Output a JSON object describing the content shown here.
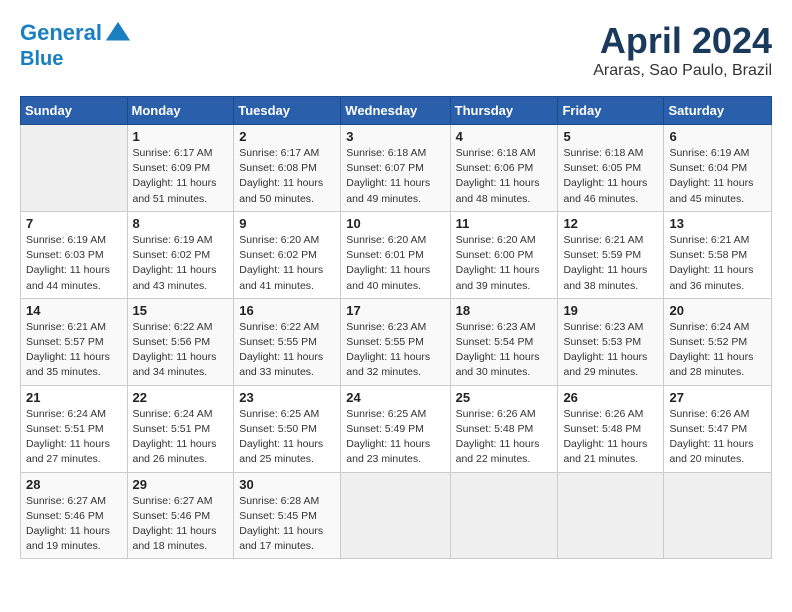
{
  "header": {
    "logo_line1": "General",
    "logo_line2": "Blue",
    "month": "April 2024",
    "location": "Araras, Sao Paulo, Brazil"
  },
  "weekdays": [
    "Sunday",
    "Monday",
    "Tuesday",
    "Wednesday",
    "Thursday",
    "Friday",
    "Saturday"
  ],
  "weeks": [
    [
      {
        "day": "",
        "detail": ""
      },
      {
        "day": "1",
        "detail": "Sunrise: 6:17 AM\nSunset: 6:09 PM\nDaylight: 11 hours\nand 51 minutes."
      },
      {
        "day": "2",
        "detail": "Sunrise: 6:17 AM\nSunset: 6:08 PM\nDaylight: 11 hours\nand 50 minutes."
      },
      {
        "day": "3",
        "detail": "Sunrise: 6:18 AM\nSunset: 6:07 PM\nDaylight: 11 hours\nand 49 minutes."
      },
      {
        "day": "4",
        "detail": "Sunrise: 6:18 AM\nSunset: 6:06 PM\nDaylight: 11 hours\nand 48 minutes."
      },
      {
        "day": "5",
        "detail": "Sunrise: 6:18 AM\nSunset: 6:05 PM\nDaylight: 11 hours\nand 46 minutes."
      },
      {
        "day": "6",
        "detail": "Sunrise: 6:19 AM\nSunset: 6:04 PM\nDaylight: 11 hours\nand 45 minutes."
      }
    ],
    [
      {
        "day": "7",
        "detail": "Sunrise: 6:19 AM\nSunset: 6:03 PM\nDaylight: 11 hours\nand 44 minutes."
      },
      {
        "day": "8",
        "detail": "Sunrise: 6:19 AM\nSunset: 6:02 PM\nDaylight: 11 hours\nand 43 minutes."
      },
      {
        "day": "9",
        "detail": "Sunrise: 6:20 AM\nSunset: 6:02 PM\nDaylight: 11 hours\nand 41 minutes."
      },
      {
        "day": "10",
        "detail": "Sunrise: 6:20 AM\nSunset: 6:01 PM\nDaylight: 11 hours\nand 40 minutes."
      },
      {
        "day": "11",
        "detail": "Sunrise: 6:20 AM\nSunset: 6:00 PM\nDaylight: 11 hours\nand 39 minutes."
      },
      {
        "day": "12",
        "detail": "Sunrise: 6:21 AM\nSunset: 5:59 PM\nDaylight: 11 hours\nand 38 minutes."
      },
      {
        "day": "13",
        "detail": "Sunrise: 6:21 AM\nSunset: 5:58 PM\nDaylight: 11 hours\nand 36 minutes."
      }
    ],
    [
      {
        "day": "14",
        "detail": "Sunrise: 6:21 AM\nSunset: 5:57 PM\nDaylight: 11 hours\nand 35 minutes."
      },
      {
        "day": "15",
        "detail": "Sunrise: 6:22 AM\nSunset: 5:56 PM\nDaylight: 11 hours\nand 34 minutes."
      },
      {
        "day": "16",
        "detail": "Sunrise: 6:22 AM\nSunset: 5:55 PM\nDaylight: 11 hours\nand 33 minutes."
      },
      {
        "day": "17",
        "detail": "Sunrise: 6:23 AM\nSunset: 5:55 PM\nDaylight: 11 hours\nand 32 minutes."
      },
      {
        "day": "18",
        "detail": "Sunrise: 6:23 AM\nSunset: 5:54 PM\nDaylight: 11 hours\nand 30 minutes."
      },
      {
        "day": "19",
        "detail": "Sunrise: 6:23 AM\nSunset: 5:53 PM\nDaylight: 11 hours\nand 29 minutes."
      },
      {
        "day": "20",
        "detail": "Sunrise: 6:24 AM\nSunset: 5:52 PM\nDaylight: 11 hours\nand 28 minutes."
      }
    ],
    [
      {
        "day": "21",
        "detail": "Sunrise: 6:24 AM\nSunset: 5:51 PM\nDaylight: 11 hours\nand 27 minutes."
      },
      {
        "day": "22",
        "detail": "Sunrise: 6:24 AM\nSunset: 5:51 PM\nDaylight: 11 hours\nand 26 minutes."
      },
      {
        "day": "23",
        "detail": "Sunrise: 6:25 AM\nSunset: 5:50 PM\nDaylight: 11 hours\nand 25 minutes."
      },
      {
        "day": "24",
        "detail": "Sunrise: 6:25 AM\nSunset: 5:49 PM\nDaylight: 11 hours\nand 23 minutes."
      },
      {
        "day": "25",
        "detail": "Sunrise: 6:26 AM\nSunset: 5:48 PM\nDaylight: 11 hours\nand 22 minutes."
      },
      {
        "day": "26",
        "detail": "Sunrise: 6:26 AM\nSunset: 5:48 PM\nDaylight: 11 hours\nand 21 minutes."
      },
      {
        "day": "27",
        "detail": "Sunrise: 6:26 AM\nSunset: 5:47 PM\nDaylight: 11 hours\nand 20 minutes."
      }
    ],
    [
      {
        "day": "28",
        "detail": "Sunrise: 6:27 AM\nSunset: 5:46 PM\nDaylight: 11 hours\nand 19 minutes."
      },
      {
        "day": "29",
        "detail": "Sunrise: 6:27 AM\nSunset: 5:46 PM\nDaylight: 11 hours\nand 18 minutes."
      },
      {
        "day": "30",
        "detail": "Sunrise: 6:28 AM\nSunset: 5:45 PM\nDaylight: 11 hours\nand 17 minutes."
      },
      {
        "day": "",
        "detail": ""
      },
      {
        "day": "",
        "detail": ""
      },
      {
        "day": "",
        "detail": ""
      },
      {
        "day": "",
        "detail": ""
      }
    ]
  ]
}
